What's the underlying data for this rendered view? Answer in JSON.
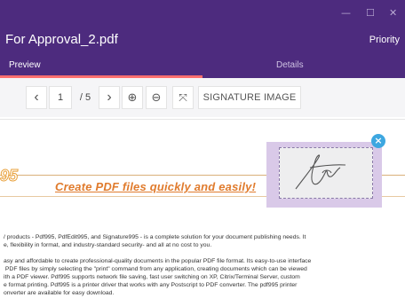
{
  "window": {
    "title": "For Approval_2.pdf",
    "priority_label": "Priority",
    "minimize_glyph": "—",
    "maximize_glyph": "☐",
    "close_glyph": "✕"
  },
  "tabs": [
    {
      "label": "Preview",
      "active": true
    },
    {
      "label": "Details",
      "active": false
    }
  ],
  "toolbar": {
    "prev_glyph": "‹",
    "current_page": "1",
    "page_total": "/ 5",
    "next_glyph": "›",
    "zoom_in_glyph": "⊕",
    "zoom_out_glyph": "⊖",
    "fit_glyph": "⤧",
    "signature_label": "SIGNATURE IMAGE"
  },
  "document": {
    "logo_text": "95",
    "headline": "Create PDF files quickly and easily!",
    "paragraphs": [
      "/ products - Pdf995, PdfEdit995, and Signature995 - is a complete solution for your document publishing needs. It\ne, flexibility in format, and industry-standard security- and all at no cost to you.",
      "asy and affordable to create professional-quality documents in the popular PDF file format. Its easy-to-use interface\n PDF files by simply selecting the \"print\" command from any application, creating documents which can be viewed\nith a PDF viewer. Pdf995 supports network file saving, fast user switching on XP, Citrix/Terminal Server, custom\ne format printing. Pdf995 is a printer driver that works with any Postscript to PDF converter. The pdf995 printer\nonverter are available for easy download."
    ]
  },
  "signature": {
    "close_glyph": "×"
  },
  "colors": {
    "header_bg": "#4d2b7e",
    "tab_underline": "#ff6f6f",
    "headline": "#e07b2d",
    "close_badge": "#3da7e0",
    "signature_overlay": "#d9c9e8"
  }
}
